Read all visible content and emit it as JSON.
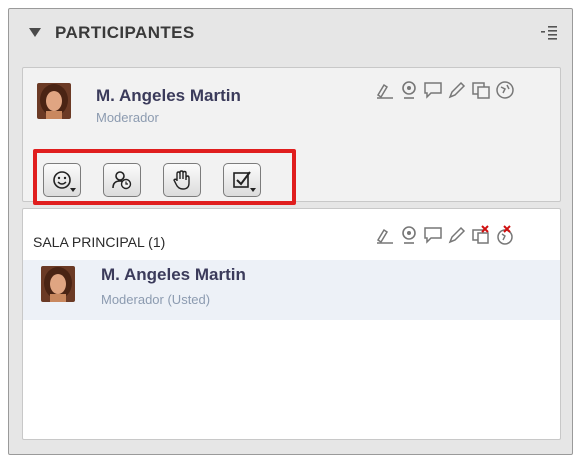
{
  "header": {
    "title": "PARTICIPANTES"
  },
  "me": {
    "name": "M. Angeles Martin",
    "role": "Moderador"
  },
  "toolbar": {
    "buttons": [
      {
        "icon": "smiley-emoticon-icon"
      },
      {
        "icon": "step-away-clock-icon"
      },
      {
        "icon": "raise-hand-icon"
      },
      {
        "icon": "poll-checkbox-icon"
      }
    ]
  },
  "room": {
    "title": "SALA PRINCIPAL (1)",
    "participant": {
      "name": "M. Angeles Martin",
      "role": "Moderador (Usted)"
    }
  },
  "permission_icons": [
    "pen-annotation-icon",
    "webcam-icon",
    "chat-icon",
    "pencil-icon",
    "share-app-icon",
    "web-tour-icon"
  ],
  "colors": {
    "highlight": "#e01e1e",
    "row_bg": "#edf1f7",
    "role_text": "#8c9bb0"
  }
}
